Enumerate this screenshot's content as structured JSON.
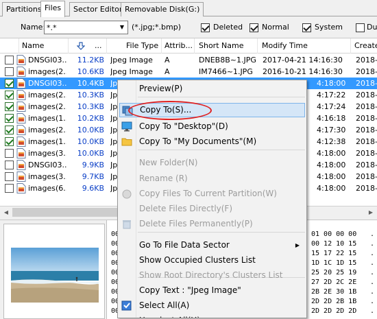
{
  "tabs": [
    {
      "label": "Partitions",
      "active": false
    },
    {
      "label": "Files",
      "active": true
    },
    {
      "label": "Sector Editor",
      "active": false
    },
    {
      "label": "Removable Disk(G:)",
      "active": false
    }
  ],
  "filter": {
    "name_label": "Name:",
    "name_value": "*.*",
    "ext_hint": "(*.jpg;*.bmp)",
    "checkboxes": [
      {
        "label": "Deleted",
        "checked": true
      },
      {
        "label": "Normal",
        "checked": true
      },
      {
        "label": "System",
        "checked": true
      },
      {
        "label": "Dup",
        "checked": false
      }
    ]
  },
  "columns": {
    "name": "Name",
    "size_sort_icon": "sort-arrow-down-icon",
    "size": "...",
    "file_type": "File Type",
    "attributes": "Attrib...",
    "short_name": "Short Name",
    "modify_time": "Modify Time",
    "create_time": "Create"
  },
  "files": [
    {
      "name": "DNSGI03...",
      "size": "11.2KB",
      "type": "Jpeg Image",
      "attr": "A",
      "short": "DNEB8B~1.JPG",
      "modified": "2017-04-21 14:16:30",
      "created": "2018-0",
      "checked": false,
      "selected": false
    },
    {
      "name": "images(2...",
      "size": "10.6KB",
      "type": "Jpeg Image",
      "attr": "A",
      "short": "IM7466~1.JPG",
      "modified": "2016-10-21 14:16:30",
      "created": "2018-0",
      "checked": false,
      "selected": false
    },
    {
      "name": "DNSGI03...",
      "size": "10.4KB",
      "type": "Jp",
      "attr": "",
      "short": "",
      "modified": "4:18:00",
      "created": "2018-0",
      "checked": true,
      "selected": true
    },
    {
      "name": "images(2...",
      "size": "10.3KB",
      "type": "Jp",
      "attr": "",
      "short": "",
      "modified": "4:17:22",
      "created": "2018-0",
      "checked": true,
      "selected": false
    },
    {
      "name": "images(2...",
      "size": "10.3KB",
      "type": "Jp",
      "attr": "",
      "short": "",
      "modified": "4:17:24",
      "created": "2018-0",
      "checked": true,
      "selected": false
    },
    {
      "name": "images(1...",
      "size": "10.2KB",
      "type": "Jp",
      "attr": "",
      "short": "",
      "modified": "4:16:18",
      "created": "2018-0",
      "checked": true,
      "selected": false
    },
    {
      "name": "images(2...",
      "size": "10.0KB",
      "type": "Jp",
      "attr": "",
      "short": "",
      "modified": "4:17:30",
      "created": "2018-0",
      "checked": true,
      "selected": false
    },
    {
      "name": "images(1...",
      "size": "10.0KB",
      "type": "Jp",
      "attr": "",
      "short": "",
      "modified": "4:12:38",
      "created": "2018-0",
      "checked": true,
      "selected": false
    },
    {
      "name": "images(3...",
      "size": "10.0KB",
      "type": "Jp",
      "attr": "",
      "short": "",
      "modified": "4:18:00",
      "created": "2018-0",
      "checked": false,
      "selected": false
    },
    {
      "name": "DNSGI03...",
      "size": "9.9KB",
      "type": "Jp",
      "attr": "",
      "short": "",
      "modified": "4:18:00",
      "created": "2018-0",
      "checked": false,
      "selected": false
    },
    {
      "name": "images(3...",
      "size": "9.7KB",
      "type": "Jp",
      "attr": "",
      "short": "",
      "modified": "4:18:00",
      "created": "2018-0",
      "checked": false,
      "selected": false
    },
    {
      "name": "images(6...",
      "size": "9.6KB",
      "type": "Jp",
      "attr": "",
      "short": "",
      "modified": "4:18:00",
      "created": "2018-0",
      "checked": false,
      "selected": false
    }
  ],
  "hex": {
    "left_rows": [
      "00",
      "00",
      "00",
      "00",
      "00",
      "00",
      "00",
      "00",
      "00"
    ],
    "right_rows": [
      "01 00 00 00",
      "00 12 10 15",
      "15 17 22 15",
      "1D 1C 1D 15",
      "25 20 25 19",
      "27 2D 2C 2E",
      "2B 2E 30 1B",
      "2D 2D 2B 1B",
      "2D 2D 2D 2D"
    ],
    "dots": [
      ".",
      ".",
      ".",
      ".",
      ".",
      ".",
      ".",
      ".",
      "."
    ]
  },
  "context_menu": {
    "items": [
      {
        "label": "Preview(P)",
        "disabled": false,
        "icon": "",
        "highlighted": false
      },
      {
        "label": "Copy To(S)...",
        "disabled": false,
        "icon": "copy-to-icon",
        "highlighted": true
      },
      {
        "label": "Copy To \"Desktop\"(D)",
        "disabled": false,
        "icon": "desktop-icon",
        "highlighted": false
      },
      {
        "label": "Copy To \"My Documents\"(M)",
        "disabled": false,
        "icon": "folder-icon",
        "highlighted": false
      },
      {
        "label": "New Folder(N)",
        "disabled": true,
        "icon": "",
        "highlighted": false
      },
      {
        "label": "Rename (R)",
        "disabled": true,
        "icon": "",
        "highlighted": false
      },
      {
        "label": "Copy Files To Current Partition(W)",
        "disabled": true,
        "icon": "copy-partition-icon",
        "highlighted": false
      },
      {
        "label": "Delete Files Directly(F)",
        "disabled": true,
        "icon": "",
        "highlighted": false
      },
      {
        "label": "Delete Files Permanently(P)",
        "disabled": true,
        "icon": "trash-icon",
        "highlighted": false
      },
      {
        "label": "Go To File Data Sector",
        "disabled": false,
        "icon": "",
        "highlighted": false,
        "submenu": true
      },
      {
        "label": "Show Occupied Clusters List",
        "disabled": false,
        "icon": "",
        "highlighted": false
      },
      {
        "label": "Show Root Directory's Clusters List",
        "disabled": true,
        "icon": "",
        "highlighted": false
      },
      {
        "label": "Copy Text : \"Jpeg Image\"",
        "disabled": false,
        "icon": "",
        "highlighted": false
      },
      {
        "label": "Select All(A)",
        "disabled": false,
        "icon": "select-all-icon",
        "highlighted": false
      },
      {
        "label": "Unselect All(U)",
        "disabled": false,
        "icon": "",
        "highlighted": false
      }
    ]
  },
  "colors": {
    "selection": "#3399ff",
    "size_text": "#0a3fc7",
    "menu_highlight": "#d5e6f7",
    "annotation_oval": "#e02020"
  }
}
